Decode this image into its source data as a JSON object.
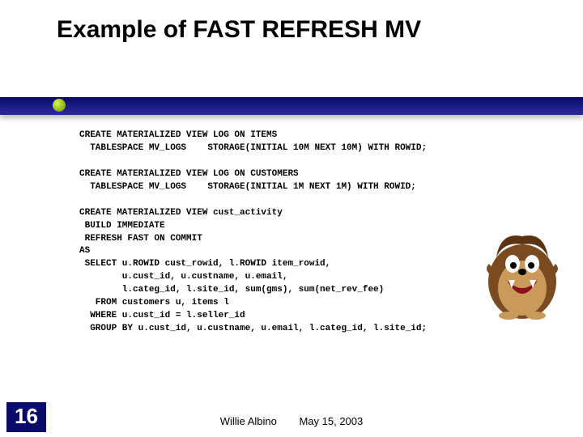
{
  "slide": {
    "title": "Example of FAST REFRESH MV",
    "page_number": "16",
    "code": "CREATE MATERIALIZED VIEW LOG ON ITEMS\n  TABLESPACE MV_LOGS    STORAGE(INITIAL 10M NEXT 10M) WITH ROWID;\n\nCREATE MATERIALIZED VIEW LOG ON CUSTOMERS\n  TABLESPACE MV_LOGS    STORAGE(INITIAL 1M NEXT 1M) WITH ROWID;\n\nCREATE MATERIALIZED VIEW cust_activity\n BUILD IMMEDIATE\n REFRESH FAST ON COMMIT\nAS\n SELECT u.ROWID cust_rowid, l.ROWID item_rowid,\n        u.cust_id, u.custname, u.email,\n        l.categ_id, l.site_id, sum(gms), sum(net_rev_fee)\n   FROM customers u, items l\n  WHERE u.cust_id = l.seller_id\n  GROUP BY u.cust_id, u.custname, u.email, l.categ_id, l.site_id;"
  },
  "footer": {
    "author": "Willie Albino",
    "date": "May 15, 2003"
  },
  "image": {
    "name": "taz-cartoon"
  }
}
